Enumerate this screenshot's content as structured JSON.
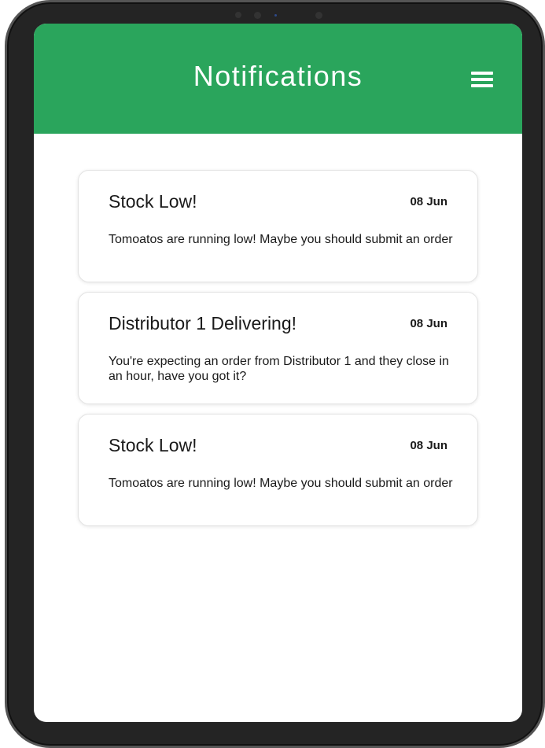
{
  "header": {
    "title": "Notifications",
    "background_color": "#2aa55c",
    "menu_icon": "hamburger-menu-icon"
  },
  "notifications": [
    {
      "title": "Stock Low!",
      "date": "08 Jun",
      "message": "Tomoatos are running low! Maybe you should submit an order"
    },
    {
      "title": "Distributor 1 Delivering!",
      "date": "08 Jun",
      "message": "You're expecting an order from Distributor 1 and they close in an hour, have you got it?"
    },
    {
      "title": "Stock Low!",
      "date": "08 Jun",
      "message": "Tomoatos are running low! Maybe you should submit an order"
    }
  ]
}
